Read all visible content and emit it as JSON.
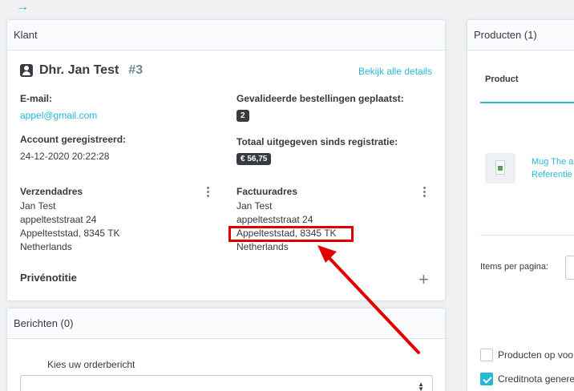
{
  "nav": {
    "back_arrow": "→"
  },
  "klant": {
    "title": "Klant",
    "customer_name": "Dhr. Jan Test",
    "customer_id": "#3",
    "details_link": "Bekijk alle details",
    "email_label": "E-mail:",
    "email_value": "appel@gmail.com",
    "account_label": "Account geregistreerd:",
    "account_value": "24-12-2020 20:22:28",
    "orders_label": "Gevalideerde bestellingen geplaatst:",
    "orders_value": "2",
    "spent_label": "Totaal uitgegeven sinds registratie:",
    "spent_value": "€ 56,75",
    "shipping": {
      "label": "Verzendadres",
      "lines": [
        "Jan Test",
        "appelteststraat 24",
        "Appelteststad, 8345 TK",
        "Netherlands"
      ]
    },
    "billing": {
      "label": "Factuuradres",
      "lines": [
        "Jan Test",
        "appelteststraat 24",
        "Appelteststad, 8345 TK",
        "Netherlands"
      ]
    },
    "private_note_label": "Privénotitie",
    "plus": "+"
  },
  "berichten": {
    "title": "Berichten (0)",
    "select_label": "Kies uw orderbericht",
    "caret_up": "▲",
    "caret_down": "▼"
  },
  "producten": {
    "title": "Producten (1)",
    "col_product": "Product",
    "product_name": "Mug The a",
    "product_ref": "Referentie",
    "items_per_page": "Items per pagina:",
    "checkbox1": "Producten op voo",
    "checkbox2": "Creditnota genere"
  },
  "colors": {
    "accent": "#25b9d7",
    "annotation": "#e00000"
  }
}
